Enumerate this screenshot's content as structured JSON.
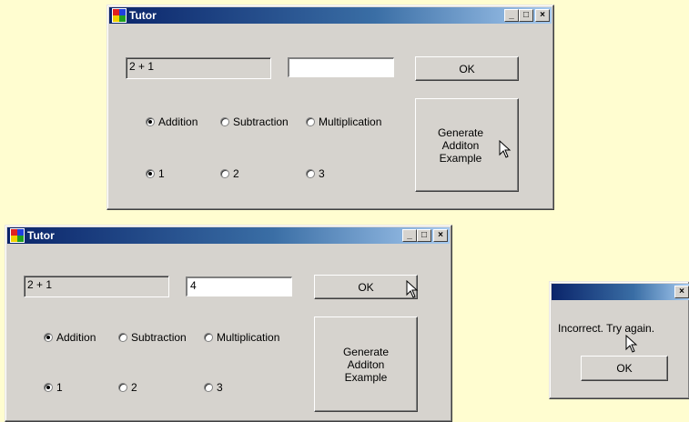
{
  "window1": {
    "title": "Tutor",
    "problem": "2 + 1",
    "answer": "",
    "ok_label": "OK",
    "generate_label": "Generate Additon Example",
    "operations": [
      {
        "label": "Addition",
        "selected": true
      },
      {
        "label": "Subtraction",
        "selected": false
      },
      {
        "label": "Multiplication",
        "selected": false
      }
    ],
    "levels": [
      {
        "label": "1",
        "selected": true
      },
      {
        "label": "2",
        "selected": false
      },
      {
        "label": "3",
        "selected": false
      }
    ]
  },
  "window2": {
    "title": "Tutor",
    "problem": "2 + 1",
    "answer": "4",
    "ok_label": "OK",
    "generate_label": "Generate Additon Example",
    "operations": [
      {
        "label": "Addition",
        "selected": true
      },
      {
        "label": "Subtraction",
        "selected": false
      },
      {
        "label": "Multiplication",
        "selected": false
      }
    ],
    "levels": [
      {
        "label": "1",
        "selected": true
      },
      {
        "label": "2",
        "selected": false
      },
      {
        "label": "3",
        "selected": false
      }
    ]
  },
  "dialog": {
    "message": "Incorrect. Try again.",
    "ok_label": "OK"
  },
  "caption_buttons": {
    "minimize": "_",
    "maximize": "□",
    "close": "×"
  },
  "colors": {
    "titlebar_start": "#0a246a",
    "titlebar_end": "#a6caf0",
    "window_face": "#d6d3ce",
    "background": "#fffdd0"
  }
}
